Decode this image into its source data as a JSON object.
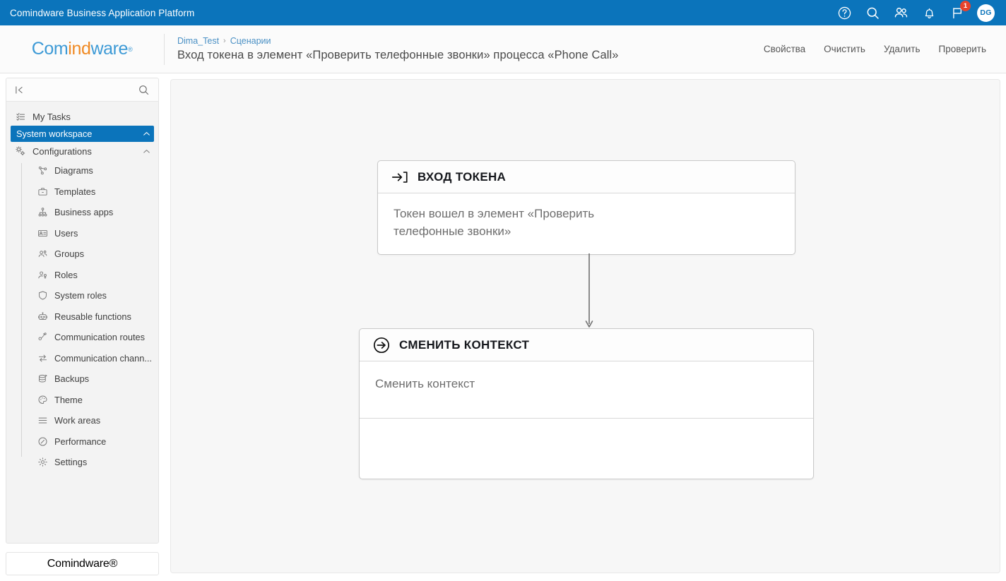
{
  "topbar": {
    "title": "Comindware Business Application Platform",
    "icons": [
      {
        "name": "help-icon",
        "glyph": "?"
      },
      {
        "name": "search-icon",
        "glyph": "search"
      },
      {
        "name": "people-icon",
        "glyph": "people"
      },
      {
        "name": "bell-icon",
        "glyph": "bell"
      },
      {
        "name": "flag-icon",
        "glyph": "flag"
      }
    ],
    "notification_count": "1",
    "avatar_initials": "DG",
    "accent_color": "#0b74bb",
    "badge_color": "#e8432c"
  },
  "header": {
    "logo": {
      "part1": "Com",
      "part2": "ind",
      "part3": "ware",
      "reg": "®"
    },
    "breadcrumb": {
      "root": "Dima_Test",
      "separator": "›",
      "current": "Сценарии"
    },
    "page_title": "Вход токена в элемент «Проверить телефонные звонки» процесса «Phone Call»",
    "actions": [
      {
        "name": "properties-action",
        "label": "Свойства"
      },
      {
        "name": "clear-action",
        "label": "Очистить"
      },
      {
        "name": "delete-action",
        "label": "Удалить"
      },
      {
        "name": "validate-action",
        "label": "Проверить"
      }
    ]
  },
  "sidebar": {
    "collapse_icon": "collapse-panel-icon",
    "search_icon": "search-icon",
    "my_tasks": {
      "label": "My Tasks",
      "icon": "tasks-list-icon"
    },
    "workspace": {
      "label": "System workspace",
      "icon": "chevron-up-icon",
      "active": true
    },
    "configurations": {
      "label": "Configurations",
      "icon": "gears-icon"
    },
    "items": [
      {
        "label": "Diagrams",
        "icon": "diagram-icon"
      },
      {
        "label": "Templates",
        "icon": "briefcase-icon"
      },
      {
        "label": "Business apps",
        "icon": "org-tree-icon"
      },
      {
        "label": "Users",
        "icon": "id-card-icon"
      },
      {
        "label": "Groups",
        "icon": "groups-icon"
      },
      {
        "label": "Roles",
        "icon": "role-person-icon"
      },
      {
        "label": "System roles",
        "icon": "shield-icon"
      },
      {
        "label": "Reusable functions",
        "icon": "robot-icon"
      },
      {
        "label": "Communication routes",
        "icon": "route-icon"
      },
      {
        "label": "Communication chann...",
        "icon": "exchange-arrows-icon"
      },
      {
        "label": "Backups",
        "icon": "database-icon"
      },
      {
        "label": "Theme",
        "icon": "palette-icon"
      },
      {
        "label": "Work areas",
        "icon": "lines-icon"
      },
      {
        "label": "Performance",
        "icon": "gauge-icon"
      },
      {
        "label": "Settings",
        "icon": "gear-icon"
      }
    ],
    "footer_logo": {
      "part1": "Com",
      "part2": "ind",
      "part3": "ware",
      "reg": "®"
    }
  },
  "canvas": {
    "cards": [
      {
        "id": "token-in",
        "icon": "arrow-into-bracket-icon",
        "title": "ВХОД ТОКЕНА",
        "body": "Токен вошел в элемент «Проверить телефонные звонки»"
      },
      {
        "id": "change-context",
        "icon": "arrow-circle-right-icon",
        "title": "СМЕНИТЬ КОНТЕКСТ",
        "body": "Сменить контекст",
        "extra_section": ""
      }
    ],
    "connector": {
      "name": "flow-arrow-down",
      "color": "#707070"
    }
  }
}
